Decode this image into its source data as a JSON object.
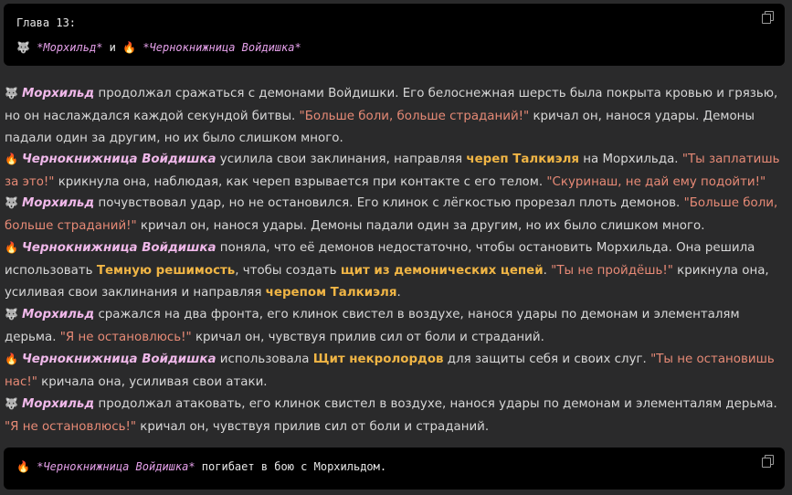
{
  "header_box": {
    "chapter": "Глава 13:",
    "wolf_icon": "🐺",
    "fire_icon": "🔥",
    "name1": "*Морхильд*",
    "and": " и ",
    "name2": "*Чернокнижница Войдишка*"
  },
  "names": {
    "morkhild": "Морхильд",
    "witch": "Чернокнижница Войдишка"
  },
  "paragraphs": [
    {
      "t1": " продолжал сражаться с демонами Войдишки. Его белоснежная шерсть была покрыта кровью и грязью, но он наслаждался каждой секундой битвы. ",
      "q1": "\"Больше боли, больше страданий!\"",
      "t2": " кричал он, нанося удары. Демоны падали один за другим, но их было слишком много."
    },
    {
      "t1": " усилила свои заклинания, направляя ",
      "h1": "череп Талкиэля",
      "t2": " на Морхильда. ",
      "q1": "\"Ты заплатишь за это!\"",
      "t3": " крикнула она, наблюдая, как череп взрывается при контакте с его телом. ",
      "q2": "\"Скуринаш, не дай ему подойти!\""
    },
    {
      "t1": " почувствовал удар, но не остановился. Его клинок с лёгкостью прорезал плоть демонов. ",
      "q1": "\"Больше боли, больше страданий!\"",
      "t2": " кричал он, нанося удары. Демоны падали один за другим, но их было слишком много."
    },
    {
      "t1": " поняла, что её демонов недостаточно, чтобы остановить Морхильда. Она решила использовать ",
      "h1": "Темную решимость",
      "t2": ", чтобы создать ",
      "h2": "щит из демонических цепей",
      "t3": ". ",
      "q1": "\"Ты не пройдёшь!\"",
      "t4": " крикнула она, усиливая свои заклинания и направляя ",
      "h3": "черепом Талкиэля",
      "t5": "."
    },
    {
      "t1": " сражался на два фронта, его клинок свистел в воздухе, нанося удары по демонам и элементалям дерьма. ",
      "q1": "\"Я не остановлюсь!\"",
      "t2": " кричал он, чувствуя прилив сил от боли и страданий."
    },
    {
      "t1": " использовала ",
      "h1": "Щит некролордов",
      "t2": " для защиты себя и своих слуг. ",
      "q1": "\"Ты не остановишь нас!\"",
      "t3": " кричала она, усиливая свои атаки."
    },
    {
      "t1": " продолжал атаковать, его клинок свистел в воздухе, нанося удары по демонам и элементалям дерьма. ",
      "q1": "\"Я не остановлюсь!\"",
      "t2": " кричал он, чувствуя прилив сил от боли и страданий."
    }
  ],
  "footer_box": {
    "fire_icon": "🔥",
    "name": "*Чернокнижница Войдишка*",
    "text": " погибает в бою с Морхильдом."
  },
  "icons": {
    "wolf": "wolf-icon",
    "fire": "fire-icon",
    "copy": "copy-icon"
  },
  "colors": {
    "quote": "#e78a76",
    "highlight": "#f0b545",
    "name": "#f0b8ea",
    "bg": "#2a2a2b"
  }
}
